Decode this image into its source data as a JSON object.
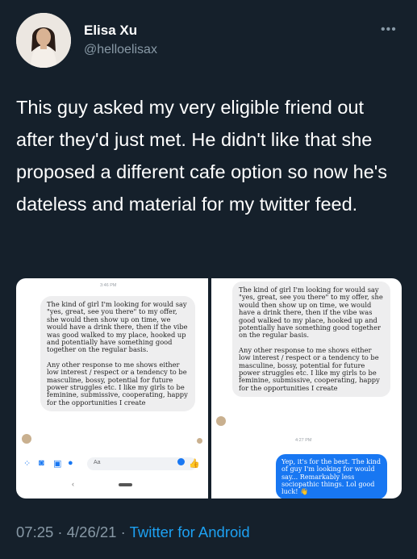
{
  "author": {
    "name": "Elisa Xu",
    "handle": "@helloelisax"
  },
  "more_glyph": "•••",
  "tweet": {
    "text": "This guy asked my very eligible friend out after they'd just met. He didn't like that she proposed a different cafe option so now he's dateless and material for my twitter feed."
  },
  "screenshot_left": {
    "time": "3:46 PM",
    "paragraph1": "The kind of girl I'm looking for would say \"yes, great, see you there\" to my offer, she would then show up on time, we would have a drink there, then if the vibe was good walked to my place, hooked up and potentially have something good together on the regular basis.",
    "paragraph2": "Any other response to me shows either low interest / respect or a tendency to be masculine, bossy, potential for future power struggles etc. I like my girls to be feminine, submissive, cooperating, happy for the opportunities I create",
    "input_placeholder": "Aa"
  },
  "screenshot_right": {
    "paragraph1": "The kind of girl I'm looking for would say \"yes, great, see you there\" to my offer, she would then show up on time, we would have a drink there, then if the vibe was good walked to my place, hooked up and potentially have something good together on the regular basis.",
    "paragraph2": "Any other response to me shows either low interest / respect or a tendency to be masculine, bossy, potential for future power struggles etc. I like my girls to be feminine, submissive, cooperating, happy for the opportunities I create",
    "time": "4:27 PM",
    "reply": "Yep, it's for the best. The kind of guy I'm looking for would say... Remarkably less sociopathic things. Lol good luck! 👋"
  },
  "meta": {
    "time": "07:25",
    "sep1": " · ",
    "date": "4/26/21",
    "sep2": " · ",
    "source": "Twitter for Android"
  },
  "colors": {
    "background": "#15202b",
    "secondary_text": "#8899a6",
    "link": "#1da1f2",
    "messenger_blue": "#1877f2"
  }
}
